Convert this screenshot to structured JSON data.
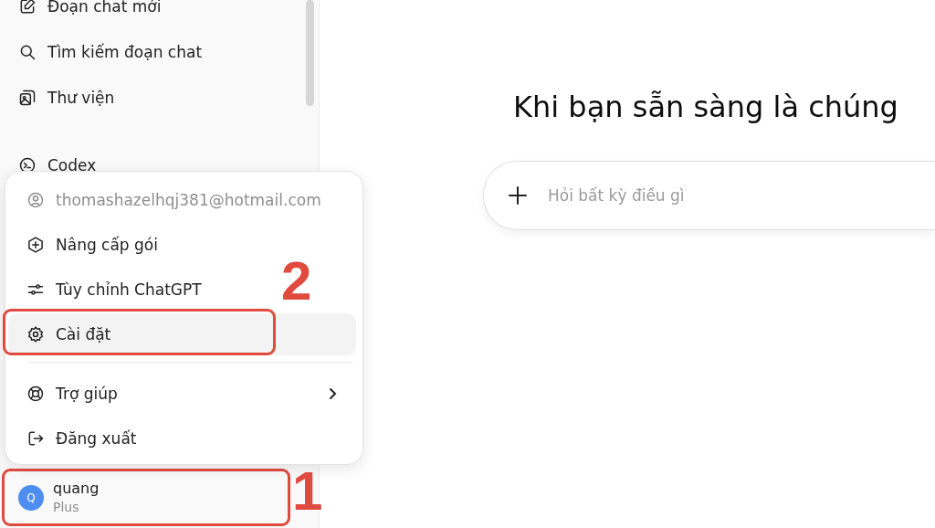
{
  "sidebar": {
    "items": [
      {
        "kind": "new-chat",
        "label": "Đoạn chat mới"
      },
      {
        "kind": "search",
        "label": "Tìm kiếm đoạn chat"
      },
      {
        "kind": "library",
        "label": "Thư viện"
      },
      {
        "kind": "codex",
        "label": "Codex"
      }
    ],
    "user": {
      "initial": "Q",
      "name": "quang",
      "plan": "Plus",
      "annotated": true
    }
  },
  "account_menu": {
    "items": [
      {
        "kind": "account",
        "label": "thomashazelhqj381@hotmail.com",
        "highlighted": false,
        "annotated": false,
        "submenu": false
      },
      {
        "kind": "upgrade",
        "label": "Nâng cấp gói",
        "highlighted": false,
        "annotated": false,
        "submenu": false
      },
      {
        "kind": "customize",
        "label": "Tùy chỉnh ChatGPT",
        "highlighted": false,
        "annotated": false,
        "submenu": false
      },
      {
        "kind": "settings",
        "label": "Cài đặt",
        "highlighted": true,
        "annotated": true,
        "submenu": false
      },
      {
        "kind": "help",
        "label": "Trợ giúp",
        "highlighted": false,
        "annotated": false,
        "submenu": true
      },
      {
        "kind": "logout",
        "label": "Đăng xuất",
        "highlighted": false,
        "annotated": false,
        "submenu": false
      }
    ]
  },
  "annotations": [
    {
      "label": "2"
    },
    {
      "label": "1"
    }
  ],
  "main": {
    "heading": "Khi bạn sẵn sàng là chúng",
    "composer": {
      "placeholder": "Hỏi bất kỳ điều gì"
    }
  }
}
